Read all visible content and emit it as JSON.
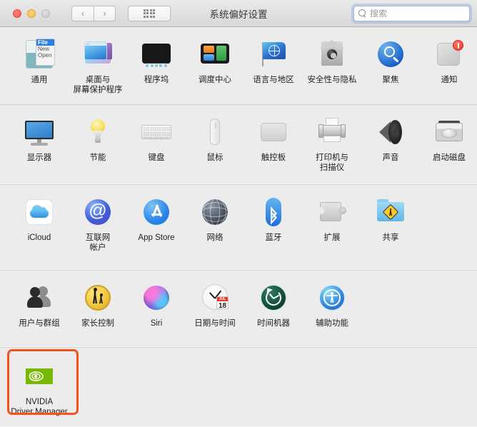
{
  "window": {
    "title": "系统偏好设置",
    "traffic_lights": [
      "close",
      "minimize",
      "zoom"
    ],
    "nav": {
      "back": "‹",
      "forward": "›"
    },
    "grid_button": "show-all-grid"
  },
  "search": {
    "placeholder": "搜索",
    "value": "",
    "icon": "search-icon"
  },
  "accent_colors": {
    "highlight_box": "#f4511e",
    "search_focus_ring": "#78a0e1",
    "notification_badge": "#e53224",
    "nvidia_green": "#76b900"
  },
  "sections": [
    {
      "name": "personal",
      "items": [
        {
          "label": "通用",
          "icon": "general-icon"
        },
        {
          "label": "桌面与\n屏幕保护程序",
          "label_line1": "桌面与",
          "label_line2": "屏幕保护程序",
          "icon": "desktop-screensaver-icon"
        },
        {
          "label": "程序坞",
          "icon": "dock-icon"
        },
        {
          "label": "调度中心",
          "icon": "mission-control-icon"
        },
        {
          "label": "语言与地区",
          "icon": "language-region-icon"
        },
        {
          "label": "安全性与隐私",
          "icon": "security-privacy-icon"
        },
        {
          "label": "聚焦",
          "icon": "spotlight-icon"
        },
        {
          "label": "通知",
          "icon": "notifications-icon",
          "badge": true
        }
      ]
    },
    {
      "name": "hardware",
      "items": [
        {
          "label": "显示器",
          "icon": "displays-icon"
        },
        {
          "label": "节能",
          "icon": "energy-saver-icon"
        },
        {
          "label": "键盘",
          "icon": "keyboard-icon"
        },
        {
          "label": "鼠标",
          "icon": "mouse-icon"
        },
        {
          "label": "触控板",
          "icon": "trackpad-icon"
        },
        {
          "label": "打印机与\n扫描仪",
          "label_line1": "打印机与",
          "label_line2": "扫描仪",
          "icon": "printers-scanners-icon"
        },
        {
          "label": "声音",
          "icon": "sound-icon"
        },
        {
          "label": "启动磁盘",
          "icon": "startup-disk-icon"
        }
      ]
    },
    {
      "name": "internet-wireless",
      "items": [
        {
          "label": "iCloud",
          "icon": "icloud-icon"
        },
        {
          "label": "互联网\n帐户",
          "label_line1": "互联网",
          "label_line2": "帐户",
          "icon": "internet-accounts-icon"
        },
        {
          "label": "App Store",
          "icon": "app-store-icon"
        },
        {
          "label": "网络",
          "icon": "network-icon"
        },
        {
          "label": "蓝牙",
          "icon": "bluetooth-icon"
        },
        {
          "label": "扩展",
          "icon": "extensions-icon"
        },
        {
          "label": "共享",
          "icon": "sharing-icon"
        }
      ]
    },
    {
      "name": "system",
      "items": [
        {
          "label": "用户与群组",
          "icon": "users-groups-icon"
        },
        {
          "label": "家长控制",
          "icon": "parental-controls-icon"
        },
        {
          "label": "Siri",
          "icon": "siri-icon"
        },
        {
          "label": "日期与时间",
          "icon": "date-time-icon"
        },
        {
          "label": "时间机器",
          "icon": "time-machine-icon"
        },
        {
          "label": "辅助功能",
          "icon": "accessibility-icon"
        }
      ]
    },
    {
      "name": "third-party",
      "items": [
        {
          "label": "NVIDIA\nDriver Manager",
          "label_line1": "NVIDIA",
          "label_line2": "Driver Manager",
          "icon": "nvidia-icon",
          "highlighted": true
        }
      ]
    }
  ],
  "date_time_icon": {
    "month": "JUL",
    "day": "18"
  },
  "general_icon_menu": {
    "title": "File",
    "items": [
      "New",
      "Open"
    ]
  }
}
